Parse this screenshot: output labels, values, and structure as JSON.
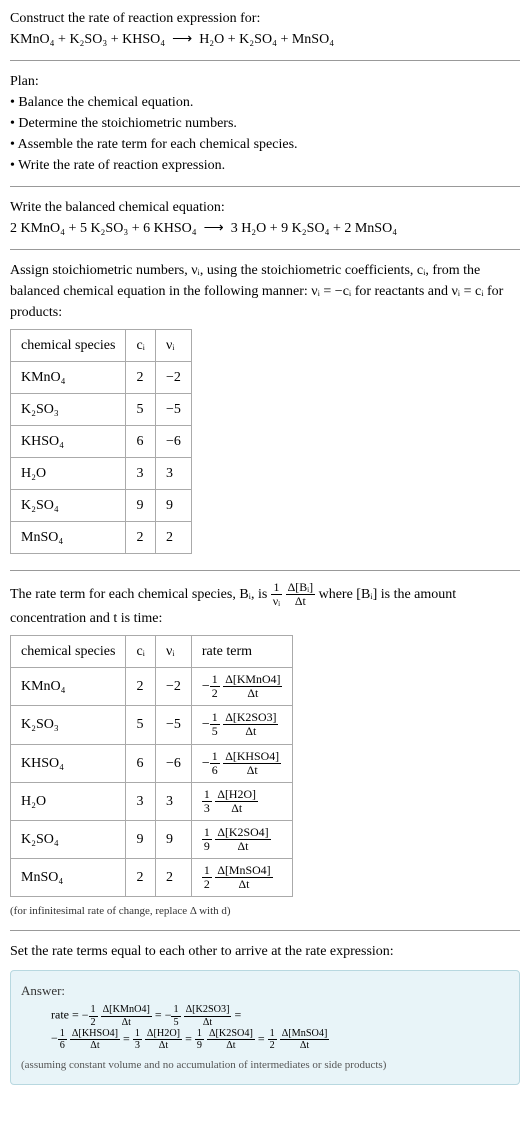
{
  "intro": {
    "line1": "Construct the rate of reaction expression for:",
    "eq_lhs": "KMnO₄ + K₂SO₃ + KHSO₄",
    "arrow": "⟶",
    "eq_rhs": "H₂O + K₂SO₄ + MnSO₄"
  },
  "plan": {
    "heading": "Plan:",
    "items": [
      "Balance the chemical equation.",
      "Determine the stoichiometric numbers.",
      "Assemble the rate term for each chemical species.",
      "Write the rate of reaction expression."
    ]
  },
  "balanced": {
    "heading": "Write the balanced chemical equation:",
    "eq_lhs": "2 KMnO₄ + 5 K₂SO₃ + 6 KHSO₄",
    "arrow": "⟶",
    "eq_rhs": "3 H₂O + 9 K₂SO₄ + 2 MnSO₄"
  },
  "stoich": {
    "para_a": "Assign stoichiometric numbers, νᵢ, using the stoichiometric coefficients, cᵢ, from the balanced chemical equation in the following manner: νᵢ = −cᵢ for reactants and νᵢ = cᵢ for products:",
    "headers": {
      "species": "chemical species",
      "ci": "cᵢ",
      "vi": "νᵢ"
    },
    "rows": [
      {
        "species": "KMnO₄",
        "ci": "2",
        "vi": "−2"
      },
      {
        "species": "K₂SO₃",
        "ci": "5",
        "vi": "−5"
      },
      {
        "species": "KHSO₄",
        "ci": "6",
        "vi": "−6"
      },
      {
        "species": "H₂O",
        "ci": "3",
        "vi": "3"
      },
      {
        "species": "K₂SO₄",
        "ci": "9",
        "vi": "9"
      },
      {
        "species": "MnSO₄",
        "ci": "2",
        "vi": "2"
      }
    ]
  },
  "rateterm": {
    "para_a": "The rate term for each chemical species, Bᵢ, is ",
    "para_b": " where [Bᵢ] is the amount concentration and t is time:",
    "headers": {
      "species": "chemical species",
      "ci": "cᵢ",
      "vi": "νᵢ",
      "rate": "rate term"
    },
    "rows": [
      {
        "species": "KMnO₄",
        "ci": "2",
        "vi": "−2",
        "sign": "−",
        "num": "1",
        "den": "2",
        "dnum": "Δ[KMnO4]",
        "dden": "Δt"
      },
      {
        "species": "K₂SO₃",
        "ci": "5",
        "vi": "−5",
        "sign": "−",
        "num": "1",
        "den": "5",
        "dnum": "Δ[K2SO3]",
        "dden": "Δt"
      },
      {
        "species": "KHSO₄",
        "ci": "6",
        "vi": "−6",
        "sign": "−",
        "num": "1",
        "den": "6",
        "dnum": "Δ[KHSO4]",
        "dden": "Δt"
      },
      {
        "species": "H₂O",
        "ci": "3",
        "vi": "3",
        "sign": "",
        "num": "1",
        "den": "3",
        "dnum": "Δ[H2O]",
        "dden": "Δt"
      },
      {
        "species": "K₂SO₄",
        "ci": "9",
        "vi": "9",
        "sign": "",
        "num": "1",
        "den": "9",
        "dnum": "Δ[K2SO4]",
        "dden": "Δt"
      },
      {
        "species": "MnSO₄",
        "ci": "2",
        "vi": "2",
        "sign": "",
        "num": "1",
        "den": "2",
        "dnum": "Δ[MnSO4]",
        "dden": "Δt"
      }
    ],
    "note": "(for infinitesimal rate of change, replace Δ with d)"
  },
  "final": {
    "heading": "Set the rate terms equal to each other to arrive at the rate expression:",
    "answer_label": "Answer:",
    "rate_prefix": "rate = ",
    "terms": [
      {
        "sign": "−",
        "num": "1",
        "den": "2",
        "dnum": "Δ[KMnO4]",
        "dden": "Δt"
      },
      {
        "sign": "−",
        "num": "1",
        "den": "5",
        "dnum": "Δ[K2SO3]",
        "dden": "Δt"
      },
      {
        "sign": "−",
        "num": "1",
        "den": "6",
        "dnum": "Δ[KHSO4]",
        "dden": "Δt"
      },
      {
        "sign": "",
        "num": "1",
        "den": "3",
        "dnum": "Δ[H2O]",
        "dden": "Δt"
      },
      {
        "sign": "",
        "num": "1",
        "den": "9",
        "dnum": "Δ[K2SO4]",
        "dden": "Δt"
      },
      {
        "sign": "",
        "num": "1",
        "den": "2",
        "dnum": "Δ[MnSO4]",
        "dden": "Δt"
      }
    ],
    "eq": " = ",
    "note": "(assuming constant volume and no accumulation of intermediates or side products)"
  }
}
